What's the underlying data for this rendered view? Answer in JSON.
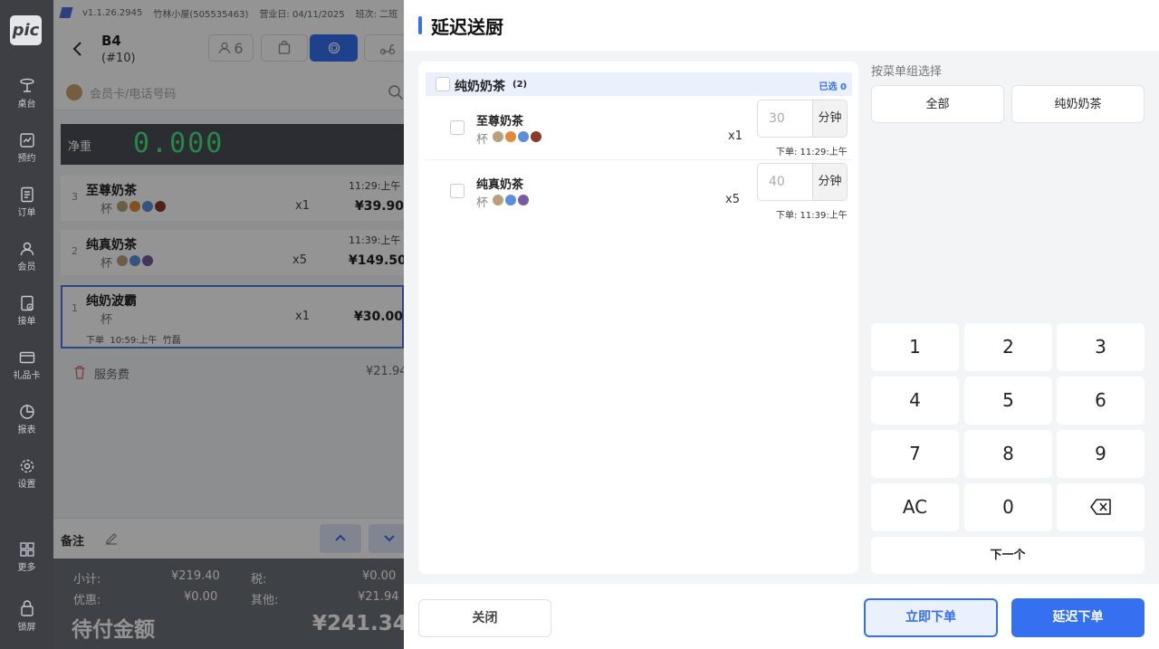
{
  "nav": {
    "logo": "pic",
    "items": [
      {
        "label": "桌台",
        "icon": "table-icon"
      },
      {
        "label": "预约",
        "icon": "calendar-icon"
      },
      {
        "label": "订单",
        "icon": "order-icon"
      },
      {
        "label": "会员",
        "icon": "member-icon"
      },
      {
        "label": "接单",
        "icon": "accept-icon"
      },
      {
        "label": "礼品卡",
        "icon": "giftcard-icon"
      },
      {
        "label": "报表",
        "icon": "report-icon"
      },
      {
        "label": "设置",
        "icon": "gear-icon"
      },
      {
        "label": "更多",
        "icon": "grid-icon"
      },
      {
        "label": "锁屏",
        "icon": "lock-icon"
      }
    ]
  },
  "topbar": {
    "version": "v1.1.26.2945",
    "store": "竹林小屋(505535463)",
    "business_date": "营业日: 04/11/2025",
    "shift": "班次: 二班"
  },
  "table": {
    "name": "B4",
    "number": "(#10)",
    "guests": "6"
  },
  "search": {
    "placeholder": "会员卡/电话号码"
  },
  "scale": {
    "label": "净重",
    "value": "0.000"
  },
  "order_items": [
    {
      "seq": "3",
      "name": "至尊奶茶",
      "unit": "杯",
      "qty": "x1",
      "price": "¥39.90",
      "time": "11:29:上午"
    },
    {
      "seq": "2",
      "name": "纯真奶茶",
      "unit": "杯",
      "qty": "x5",
      "price": "¥149.50",
      "time": "11:39:上午"
    },
    {
      "seq": "1",
      "name": "纯奶波霸",
      "unit": "杯",
      "qty": "x1",
      "price": "¥30.00",
      "meta": "下单  10:59:上午  竹磊"
    }
  ],
  "service_fee": {
    "label": "服务费",
    "amount": "¥21.94"
  },
  "remark": {
    "label": "备注"
  },
  "summary": {
    "subtotal_label": "小计:",
    "subtotal": "¥219.40",
    "tax_label": "税:",
    "tax": "¥0.00",
    "discount_label": "优惠:",
    "discount": "¥0.00",
    "other_label": "其他:",
    "other": "¥21.94",
    "due_label": "待付金额",
    "due": "¥241.34"
  },
  "modal": {
    "title": "延迟送厨",
    "group": {
      "name": "纯奶奶茶",
      "count": "(2)",
      "selected": "已选 0"
    },
    "items": [
      {
        "name": "至尊奶茶",
        "unit": "杯",
        "qty": "x1",
        "minutes": "30",
        "minutes_unit": "分钟",
        "order_time": "下单: 11:29:上午"
      },
      {
        "name": "纯真奶茶",
        "unit": "杯",
        "qty": "x5",
        "minutes": "40",
        "minutes_unit": "分钟",
        "order_time": "下单: 11:39:上午"
      }
    ],
    "group_select_label": "按菜单组选择",
    "group_buttons": [
      "全部",
      "纯奶奶茶"
    ],
    "keypad": [
      "1",
      "2",
      "3",
      "4",
      "5",
      "6",
      "7",
      "8",
      "9",
      "AC",
      "0"
    ],
    "next_label": "下一个",
    "close_label": "关闭",
    "order_now_label": "立即下单",
    "delay_order_label": "延迟下单"
  },
  "colors": {
    "accent": "#3470f0",
    "nav_bg": "#3d3f45",
    "panel_bg": "#f3f4f6"
  }
}
